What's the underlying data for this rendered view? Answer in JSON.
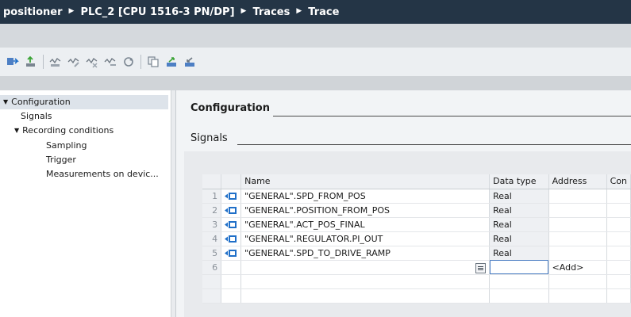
{
  "breadcrumb": {
    "items": [
      "positioner",
      "PLC_2 [CPU 1516-3 PN/DP]",
      "Traces",
      "Trace"
    ],
    "separator": "▶"
  },
  "toolbar": {
    "buttons": [
      "transfer-icon",
      "upload-icon",
      "add-trace-icon",
      "edit-icon",
      "delete-icon",
      "remove-icon",
      "refresh-icon",
      "copy-icon",
      "import-icon",
      "export-icon"
    ]
  },
  "tree": {
    "items": [
      {
        "label": "Configuration",
        "expanded": true,
        "selected": true
      },
      {
        "label": "Signals"
      },
      {
        "label": "Recording conditions",
        "expanded": true
      },
      {
        "label": "Sampling"
      },
      {
        "label": "Trigger"
      },
      {
        "label": "Measurements on devic..."
      }
    ]
  },
  "main": {
    "section_title": "Configuration",
    "subsection_title": "Signals"
  },
  "table": {
    "columns": [
      "Name",
      "Data type",
      "Address",
      "Con"
    ],
    "rows": [
      {
        "num": "1",
        "name": "\"GENERAL\".SPD_FROM_POS",
        "type": "Real"
      },
      {
        "num": "2",
        "name": "\"GENERAL\".POSITION_FROM_POS",
        "type": "Real"
      },
      {
        "num": "3",
        "name": "\"GENERAL\".ACT_POS_FINAL",
        "type": "Real"
      },
      {
        "num": "4",
        "name": "\"GENERAL\".REGULATOR.PI_OUT",
        "type": "Real"
      },
      {
        "num": "5",
        "name": "\"GENERAL\".SPD_TO_DRIVE_RAMP",
        "type": "Real"
      }
    ],
    "new_row": {
      "num": "6",
      "add_label": "<Add>"
    }
  },
  "colors": {
    "title_bg": "#243546",
    "accent_blue": "#1f6fc8",
    "accent_green": "#3aa335"
  }
}
